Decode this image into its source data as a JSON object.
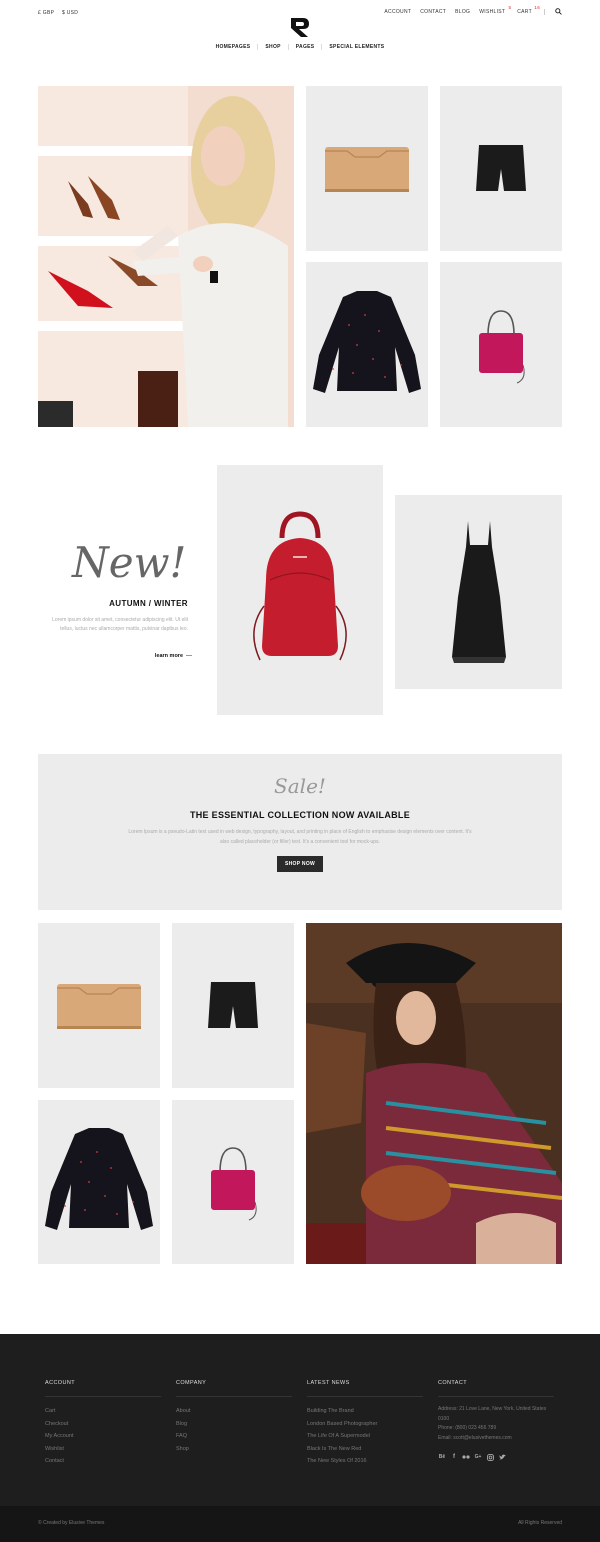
{
  "currency": {
    "gbp": "£ GBP",
    "usd": "$ USD"
  },
  "toplinks": {
    "account": "ACCOUNT",
    "contact": "CONTACT",
    "blog": "BLOG",
    "wishlist": "WISHLIST",
    "wishlist_count": "5",
    "cart": "CART",
    "cart_count": "16"
  },
  "nav": {
    "homepages": "HOMEPAGES",
    "shop": "SHOP",
    "pages": "PAGES",
    "special": "SPECIAL ELEMENTS"
  },
  "new_section": {
    "script": "New!",
    "title": "AUTUMN / WINTER",
    "text": "Lorem ipsum dolor sit amet, consectetur adipiscing elit. Ut elit tellus, luctus nec ullamcorper mattis, pulvinar dapibus leo.",
    "link": "learn more"
  },
  "sale": {
    "script": "Sale!",
    "title": "THE ESSENTIAL COLLECTION NOW AVAILABLE",
    "text": "Lorem Ipsum is a pseudo-Latin text used in web design, typography, layout, and printing in place of English to emphasise design elements over content. It's also called placeholder (or filler) text. It's a convenient tool for mock-ups.",
    "button": "SHOP NOW"
  },
  "footer": {
    "account": {
      "heading": "ACCOUNT",
      "links": [
        "Cart",
        "Checkout",
        "My Account",
        "Wishlist",
        "Contact"
      ]
    },
    "company": {
      "heading": "COMPANY",
      "links": [
        "About",
        "Blog",
        "FAQ",
        "Shop"
      ]
    },
    "news": {
      "heading": "LATEST NEWS",
      "links": [
        "Building The Brand",
        "London Based Photographer",
        "The Life Of A Supermodel",
        "Black Is The New Red",
        "The New Styles Of 2016"
      ]
    },
    "contact": {
      "heading": "CONTACT",
      "address": "Address: 21 Love Lane, New York, United States 0100",
      "phone": "Phone: (800) 023 456 789",
      "email": "Email: scott@elusivethemes.com"
    },
    "social_icons": [
      "behance-icon",
      "facebook-icon",
      "flickr-icon",
      "google-plus-icon",
      "instagram-icon",
      "twitter-icon"
    ]
  },
  "bottom": {
    "credit": "©  Created by Elusive Themes",
    "rights": "All Rights Reserved"
  },
  "colors": {
    "accent_red": "#e0262d",
    "footer_bg": "#1e1e1e",
    "tile_bg": "#ececec",
    "bag_pink": "#c2185b",
    "backpack_red": "#c41e2e"
  }
}
